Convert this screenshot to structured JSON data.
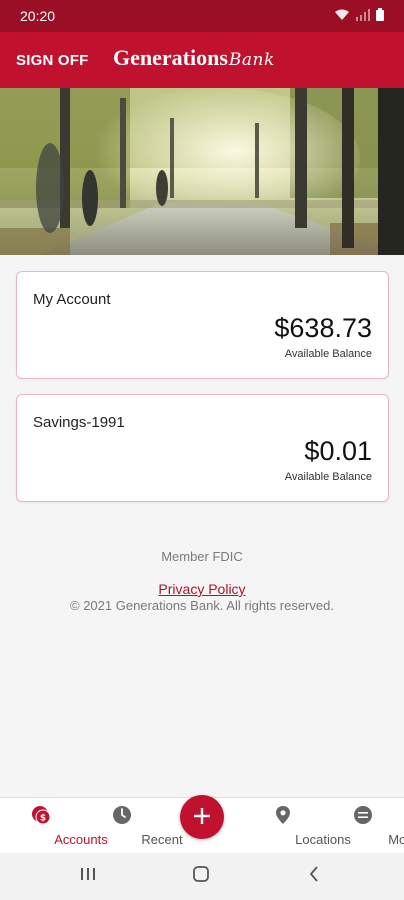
{
  "status_bar": {
    "time": "20:20"
  },
  "header": {
    "sign_off": "SIGN OFF",
    "brand_main": "Generations",
    "brand_sub": "Bank"
  },
  "accounts": [
    {
      "name": "My Account",
      "balance": "$638.73",
      "balance_label": "Available Balance"
    },
    {
      "name": "Savings-1991",
      "balance": "$0.01",
      "balance_label": "Available Balance"
    }
  ],
  "footer": {
    "member": "Member FDIC",
    "privacy": "Privacy Policy",
    "copyright": "© 2021 Generations Bank. All rights reserved."
  },
  "bottom_nav": {
    "items": [
      {
        "label": "Accounts",
        "icon": "accounts-icon",
        "active": true
      },
      {
        "label": "Recent",
        "icon": "clock-icon",
        "active": false
      },
      {
        "label": "Locations",
        "icon": "location-pin-icon",
        "active": false
      },
      {
        "label": "More",
        "icon": "more-icon",
        "active": false
      }
    ],
    "fab_icon": "plus-icon"
  },
  "colors": {
    "brand": "#c0122e",
    "brand_dark": "#9b0f26",
    "link": "#b0122a"
  }
}
